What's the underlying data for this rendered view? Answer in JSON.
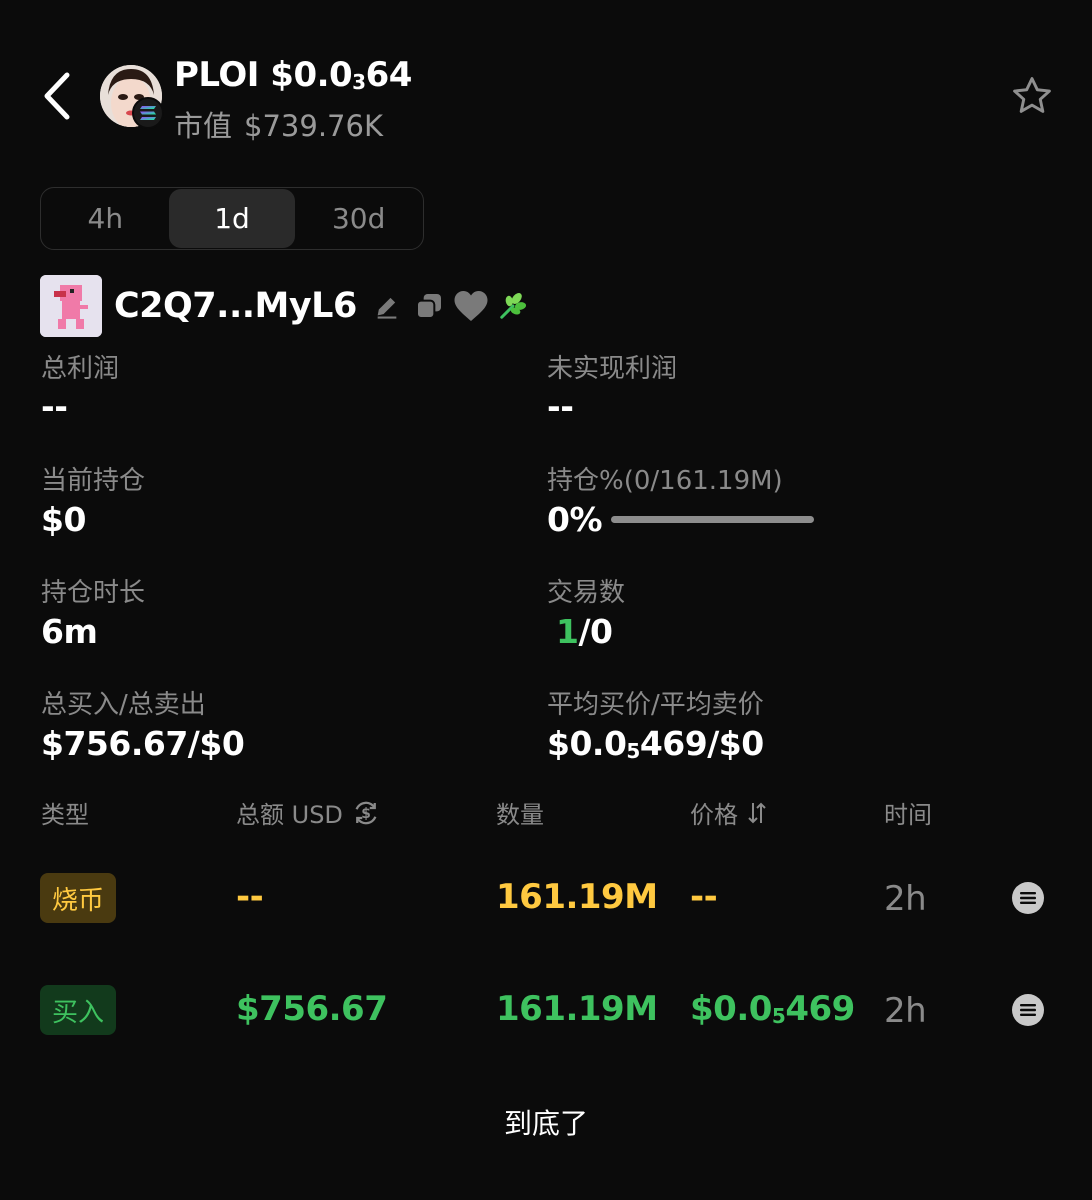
{
  "header": {
    "symbol": "PLOI",
    "price_prefix": "$0.0",
    "price_zeros": "3",
    "price_digits": "64",
    "mcap_label": "市值",
    "mcap_value": "$739.76K"
  },
  "timeframes": [
    {
      "label": "4h",
      "active": false
    },
    {
      "label": "1d",
      "active": true
    },
    {
      "label": "30d",
      "active": false
    }
  ],
  "wallet": {
    "address": "C2Q7...MyL6"
  },
  "stats": {
    "total_profit": {
      "label": "总利润",
      "value": "--"
    },
    "unrealized_profit": {
      "label": "未实现利润",
      "value": "--"
    },
    "current_position": {
      "label": "当前持仓",
      "value": "$0"
    },
    "holding_pct": {
      "label": "持仓%(0/161.19M)",
      "value": "0%",
      "fraction": 0
    },
    "holding_duration": {
      "label": "持仓时长",
      "value": "6m"
    },
    "trade_count": {
      "label": "交易数",
      "buys": "1",
      "sep_sells": "/0"
    },
    "total_buy_sell": {
      "label": "总买入/总卖出",
      "value": "$756.67/$0"
    },
    "avg_price": {
      "label": "平均买价/平均卖价",
      "prefix": "$0.0",
      "zeros": "5",
      "digits": "469/$0"
    }
  },
  "table": {
    "headers": {
      "type": "类型",
      "amount": "总额 USD",
      "quantity": "数量",
      "price": "价格",
      "time": "时间"
    },
    "rows": [
      {
        "type": "烧币",
        "amount": "--",
        "quantity": "161.19M",
        "price_prefix": "--",
        "price_zeros": "",
        "price_digits": "",
        "time": "2h"
      },
      {
        "type": "买入",
        "amount": "$756.67",
        "quantity": "161.19M",
        "price_prefix": "$0.0",
        "price_zeros": "5",
        "price_digits": "469",
        "time": "2h"
      }
    ]
  },
  "footer": {
    "end_text": "到底了"
  },
  "colors": {
    "background": "#0b0b0b",
    "positive": "#3ec25f",
    "burn": "#ffc940",
    "muted": "#8a8a8a"
  },
  "icons": [
    "back-arrow-icon",
    "solana-icon",
    "star-icon",
    "edit-icon",
    "copy-icon",
    "heart-icon",
    "leaf-icon",
    "usd-swap-icon",
    "sort-icon",
    "menu-lines-icon"
  ]
}
